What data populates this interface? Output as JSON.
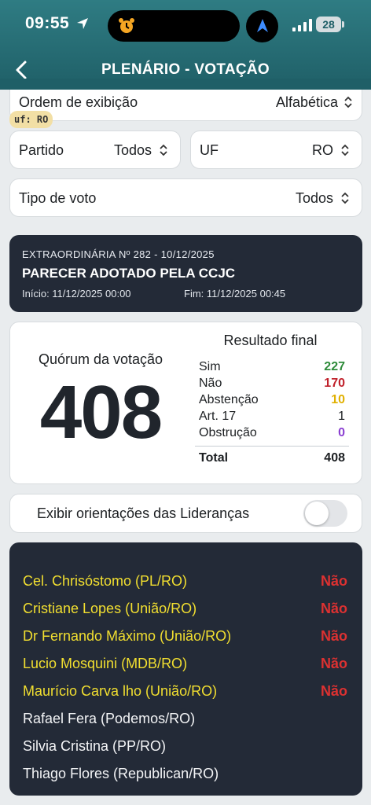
{
  "status_bar": {
    "time": "09:55",
    "battery": "28"
  },
  "header": {
    "title": "PLENÁRIO - VOTAÇÃO"
  },
  "filters": {
    "order": {
      "label": "Ordem de exibição",
      "value": "Alfabética"
    },
    "chip": "uf: RO",
    "party": {
      "label": "Partido",
      "value": "Todos"
    },
    "uf": {
      "label": "UF",
      "value": "RO"
    },
    "vote_type": {
      "label": "Tipo de voto",
      "value": "Todos"
    }
  },
  "session": {
    "heading": "EXTRAORDINÁRIA Nº 282 - 10/12/2025",
    "title": "PARECER ADOTADO PELA CCJC",
    "start": "Início: 11/12/2025 00:00",
    "end": "Fim: 11/12/2025 00:45"
  },
  "quorum": {
    "label": "Quórum da votação",
    "value": "408"
  },
  "result": {
    "title": "Resultado final",
    "rows": [
      {
        "label": "Sim",
        "value": "227",
        "color": "#2e8b3a"
      },
      {
        "label": "Não",
        "value": "170",
        "color": "#c0202a"
      },
      {
        "label": "Abstenção",
        "value": "10",
        "color": "#e0b000"
      },
      {
        "label": "Art. 17",
        "value": "1",
        "color": "#1c1f22"
      },
      {
        "label": "Obstrução",
        "value": "0",
        "color": "#8a3fd1"
      }
    ],
    "total_label": "Total",
    "total_value": "408"
  },
  "leaders_toggle": {
    "label": "Exibir orientações das Lideranças",
    "on": false
  },
  "deputies": [
    {
      "name": "Cel. Chrisóstomo (PL/RO)",
      "vote": "Não",
      "highlight": true
    },
    {
      "name": "Cristiane Lopes (União/RO)",
      "vote": "Não",
      "highlight": true
    },
    {
      "name": "Dr Fernando Máximo (União/RO)",
      "vote": "Não",
      "highlight": true
    },
    {
      "name": "Lucio Mosquini (MDB/RO)",
      "vote": "Não",
      "highlight": true
    },
    {
      "name": "Maurício Carva lho (União/RO)",
      "vote": "Não",
      "highlight": true
    },
    {
      "name": "Rafael Fera (Podemos/RO)",
      "vote": "",
      "highlight": false
    },
    {
      "name": "Silvia Cristina (PP/RO)",
      "vote": "",
      "highlight": false
    },
    {
      "name": "Thiago Flores (Republican/RO)",
      "vote": "",
      "highlight": false
    }
  ],
  "colors": {
    "header": "#2a6f77",
    "dark_card": "#232a37",
    "highlight_name": "#f2df30",
    "vote_no": "#dd3131"
  }
}
